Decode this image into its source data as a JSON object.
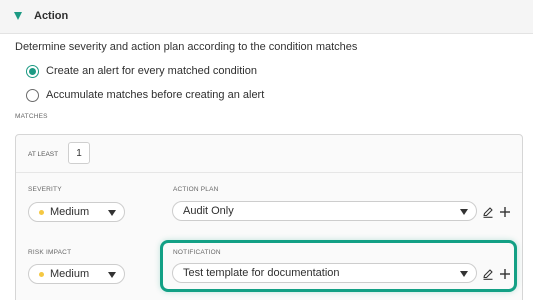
{
  "section": {
    "title": "Action"
  },
  "description": "Determine severity and action plan according to the condition matches",
  "mode_options": [
    {
      "label": "Create an alert for every matched condition",
      "selected": true
    },
    {
      "label": "Accumulate matches before creating an alert",
      "selected": false
    }
  ],
  "matches": {
    "label": "MATCHES",
    "at_least_label": "AT LEAST",
    "at_least_value": "1"
  },
  "severity": {
    "label": "SEVERITY",
    "value": "Medium"
  },
  "action_plan": {
    "label": "ACTION PLAN",
    "value": "Audit Only"
  },
  "risk_impact": {
    "label": "RISK IMPACT",
    "value": "Medium"
  },
  "notification": {
    "label": "NOTIFICATION",
    "value": "Test template for documentation"
  },
  "colors": {
    "accent": "#1c9a83",
    "highlight": "#13a085",
    "medium_dot": "#f5c842"
  },
  "icons": [
    "caret-down-icon",
    "edit-pencil-icon",
    "add-plus-icon",
    "dropdown-arrow-icon"
  ]
}
